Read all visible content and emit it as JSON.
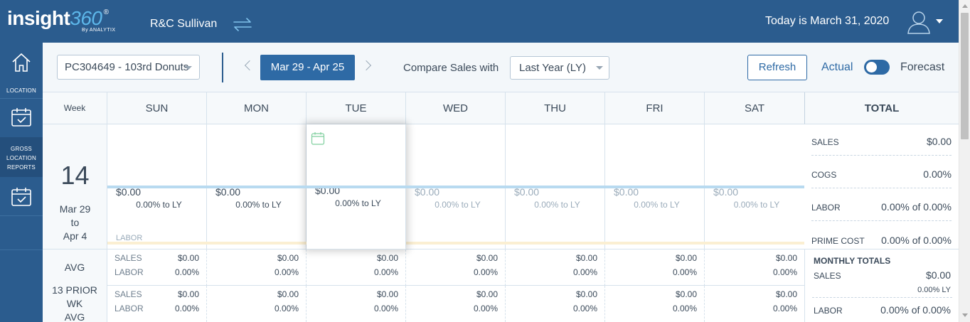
{
  "app": {
    "logo_main": "insight",
    "logo_num": "360",
    "logo_reg": "®",
    "logo_sub": "By ANALYTIX",
    "company": "R&C Sullivan",
    "today": "Today is March 31, 2020"
  },
  "sidebar": {
    "location_label": "LOCATION",
    "reports_label_1": "GROSS",
    "reports_label_2": "LOCATION",
    "reports_label_3": "REPORTS"
  },
  "toolbar": {
    "location_value": "PC304649 - 103rd Donuts",
    "date_range": "Mar 29 - Apr 25",
    "compare_label": "Compare Sales with",
    "compare_value": "Last Year (LY)",
    "refresh_label": "Refresh",
    "actual_label": "Actual",
    "forecast_label": "Forecast"
  },
  "grid": {
    "week_header": "Week",
    "total_header": "TOTAL",
    "days": [
      "SUN",
      "MON",
      "TUE",
      "WED",
      "THU",
      "FRI",
      "SAT"
    ],
    "week_number": "14",
    "week_start": "Mar 29",
    "week_to": "to",
    "week_end": "Apr 4",
    "day_sales": "$0.00",
    "day_ly": "0.00% to LY",
    "labor_label": "LABOR"
  },
  "totals": {
    "sales_label": "SALES",
    "sales_value": "$0.00",
    "cogs_label": "COGS",
    "cogs_value": "0.00%",
    "labor_label": "LABOR",
    "labor_value": "0.00% of 0.00%",
    "prime_label": "PRIME COST",
    "prime_value": "0.00% of 0.00%"
  },
  "rows": {
    "avg_label": "AVG",
    "prior_label_1": "13 PRIOR WK",
    "prior_label_2": "AVG",
    "sales_label": "SALES",
    "labor_label": "LABOR",
    "sales_value": "$0.00",
    "labor_value": "0.00%"
  },
  "monthly": {
    "title": "MONTHLY TOTALS",
    "sales_label": "SALES",
    "sales_value": "$0.00",
    "ly_value": "0.00% LY",
    "labor_label": "LABOR",
    "labor_value": "0.00% of 0.00%"
  },
  "colors": {
    "brand": "#2b5c8e",
    "accent": "#2e6aa5",
    "sales_line": "#b8daf0"
  }
}
